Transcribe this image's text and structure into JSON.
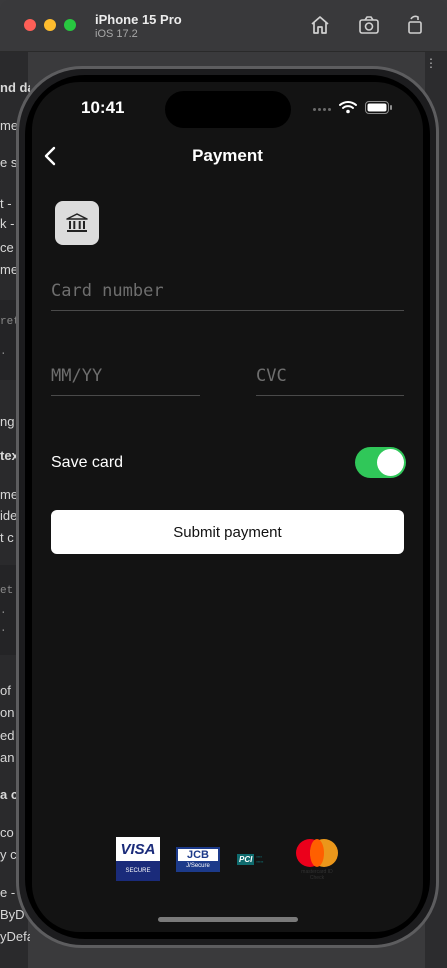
{
  "simulator": {
    "device_name": "iPhone 15 Pro",
    "os_version": "iOS 17.2"
  },
  "background": {
    "left_text_fragments": [
      "nd da",
      "me",
      "e s",
      "t -",
      "k -",
      "ce",
      "me",
      "ng",
      "tex",
      "me",
      "ide",
      "t c",
      "of",
      "on",
      "ed",
      "an",
      "a c",
      "co",
      "y c",
      "e -",
      "ByD",
      "yDefaul"
    ],
    "code_fragments": [
      "ret",
      ".",
      "et",
      ".",
      "."
    ]
  },
  "status_bar": {
    "time": "10:41"
  },
  "nav": {
    "title": "Payment"
  },
  "form": {
    "card_number_placeholder": "Card number",
    "expiry_placeholder": "MM/YY",
    "cvc_placeholder": "CVC",
    "save_card_label": "Save card",
    "save_card_enabled": true,
    "submit_label": "Submit payment"
  },
  "brands": {
    "visa_name": "VISA",
    "visa_secure": "SECURE",
    "jcb_name": "JCB",
    "jcb_secure": "J/Secure",
    "pci_name": "PCI",
    "mastercard_text": "mastercard ID Check"
  },
  "colors": {
    "screen_background": "#131313",
    "toggle_on": "#30c759",
    "submit_background": "#ffffff"
  }
}
